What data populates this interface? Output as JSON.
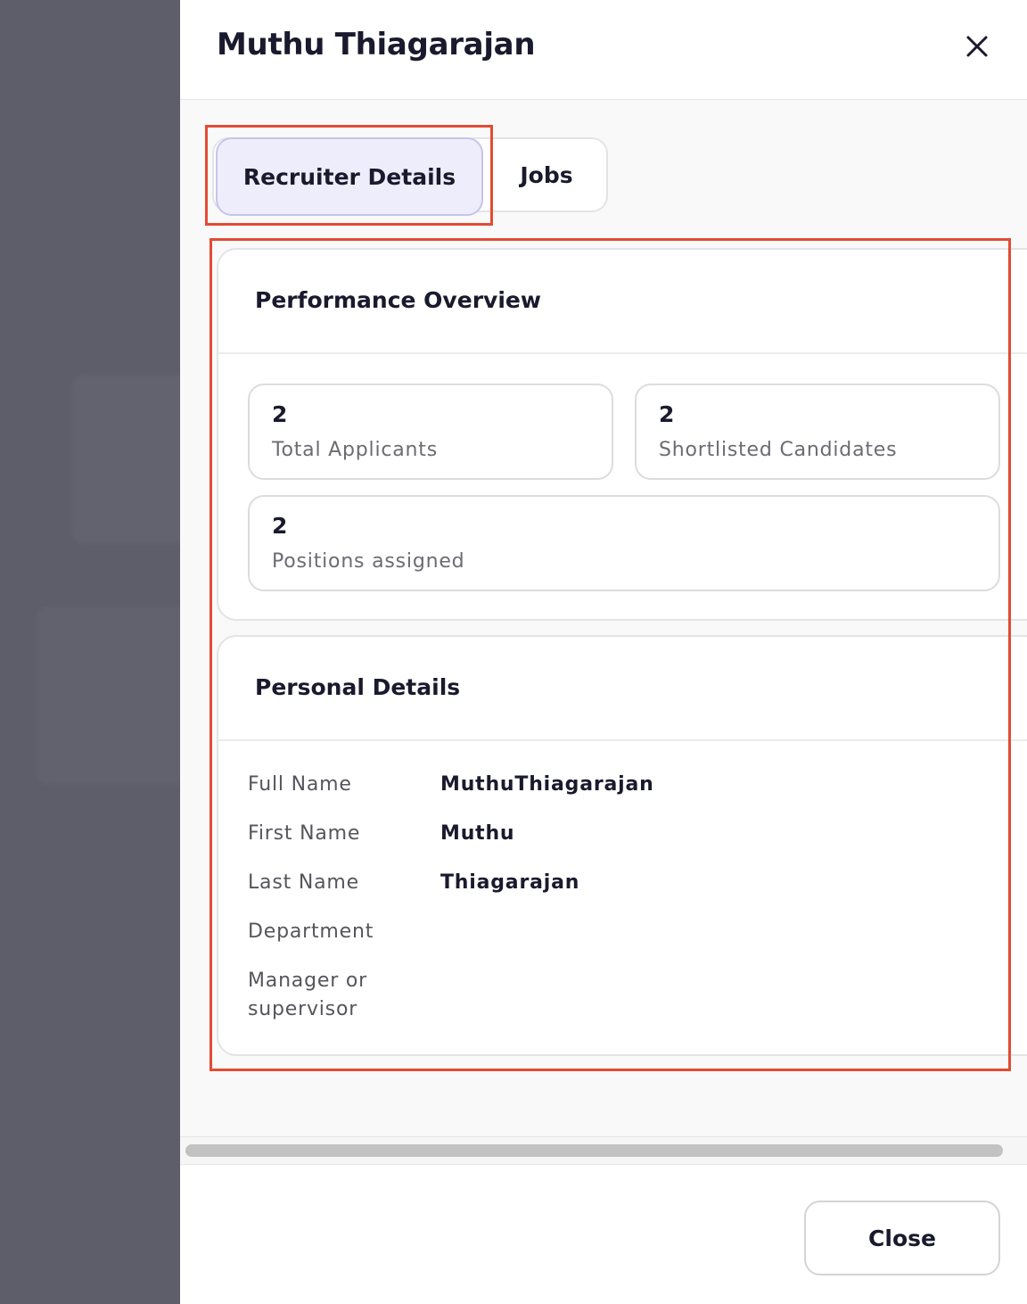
{
  "drawer": {
    "title": "Muthu Thiagarajan",
    "close_icon": "close-icon"
  },
  "tabs": [
    {
      "label": "Recruiter Details",
      "active": true
    },
    {
      "label": "Jobs",
      "active": false
    }
  ],
  "performance": {
    "heading": "Performance Overview",
    "stats": [
      {
        "value": "2",
        "label": "Total Applicants"
      },
      {
        "value": "2",
        "label": "Shortlisted Candidates"
      },
      {
        "value": "2",
        "label": "Positions assigned"
      }
    ]
  },
  "personal": {
    "heading": "Personal Details",
    "rows": [
      {
        "label": "Full Name",
        "value": "MuthuThiagarajan"
      },
      {
        "label": "First Name",
        "value": "Muthu"
      },
      {
        "label": "Last Name",
        "value": "Thiagarajan"
      },
      {
        "label": "Department",
        "value": ""
      },
      {
        "label": "Manager or supervisor",
        "value": ""
      }
    ]
  },
  "footer": {
    "close_label": "Close"
  },
  "colors": {
    "highlight": "#e34b33",
    "tab_active_bg": "#eeedfb",
    "backdrop": "#5e5e6a"
  }
}
